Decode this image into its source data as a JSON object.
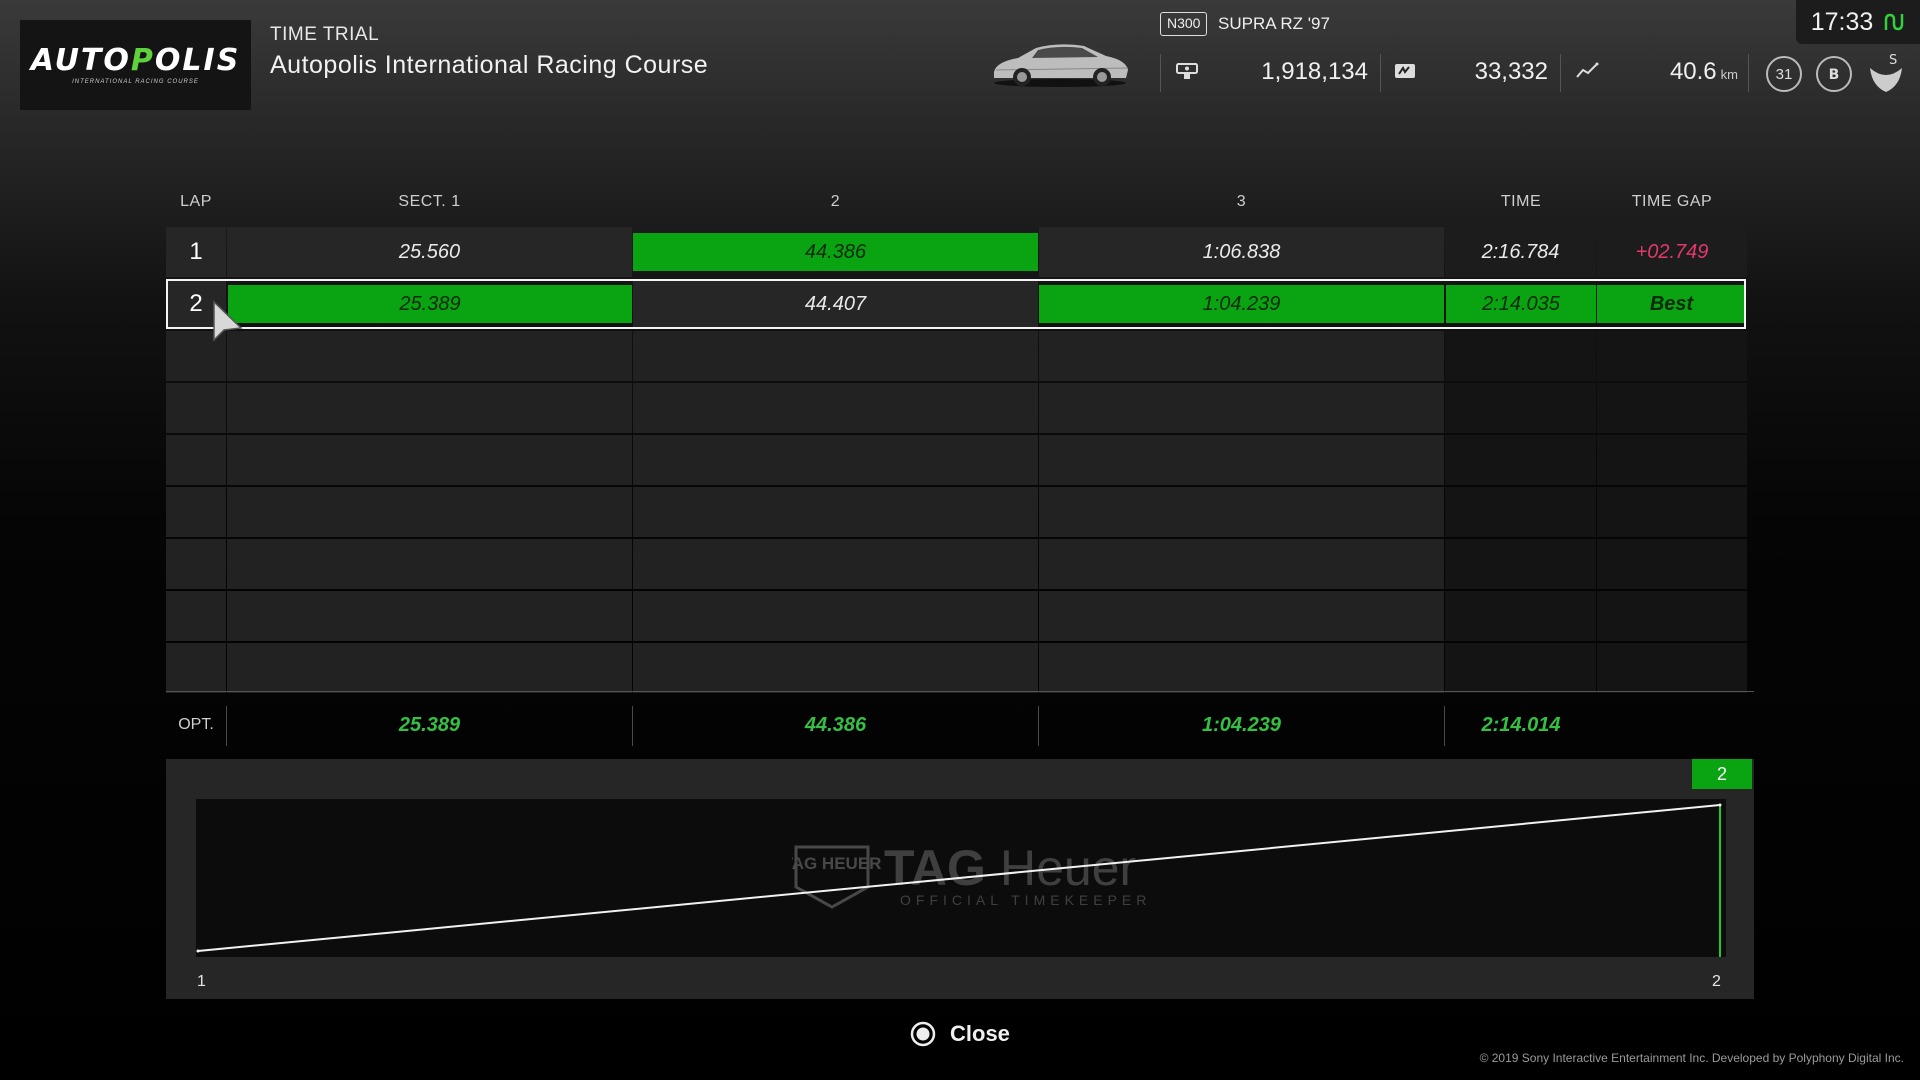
{
  "header": {
    "logo": {
      "text_white_1": "AUTO",
      "text_green": "P",
      "text_white_2": "OLIS",
      "subtitle": "INTERNATIONAL RACING COURSE"
    },
    "event_type": "TIME TRIAL",
    "track_name": "Autopolis International Racing Course",
    "car": {
      "class": "N300",
      "name": "SUPRA RZ '97"
    },
    "stats": {
      "credits": "1,918,134",
      "mileage_points": "33,332",
      "distance": "40.6",
      "distance_unit": "km",
      "level": "31"
    },
    "clock": "17:33",
    "icons": [
      "credits-icon",
      "mileage-icon",
      "distance-icon",
      "level-badge-icon",
      "driver-rating-icon",
      "sportsmanship-rating-icon",
      "network-status-icon"
    ]
  },
  "table": {
    "headers": {
      "lap": "LAP",
      "sect1": "SECT. 1",
      "sect2": "2",
      "sect3": "3",
      "time": "TIME",
      "gap": "TIME GAP"
    },
    "laps": [
      {
        "lap": "1",
        "sect1": "25.560",
        "sect2": "44.386",
        "sect3": "1:06.838",
        "time": "2:16.784",
        "gap": "+02.749"
      },
      {
        "lap": "2",
        "sect1": "25.389",
        "sect2": "44.407",
        "sect3": "1:04.239",
        "time": "2:14.035",
        "gap": "Best"
      }
    ],
    "selected_lap": "2",
    "optimal": {
      "label": "OPT.",
      "sect1": "25.389",
      "sect2": "44.386",
      "sect3": "1:04.239",
      "time": "2:14.014"
    },
    "colors": {
      "best_sector": "#0aa312",
      "optimal_text": "#35c043",
      "slower_gap": "#e3386c"
    }
  },
  "chart": {
    "badge": "2",
    "x_labels": [
      "1",
      "2"
    ],
    "watermark": {
      "brand_a": "TAG",
      "brand_b": "Heuer",
      "tagline": "OFFICIAL TIMEKEEPER",
      "shield": "TAG HEUER"
    }
  },
  "chart_data": {
    "type": "line",
    "x": [
      1,
      2
    ],
    "series": [
      {
        "values": [
          0,
          1
        ]
      }
    ],
    "xlabel": "",
    "ylabel": ""
  },
  "footer": {
    "close_label": "Close",
    "copyright": "© 2019 Sony Interactive Entertainment Inc. Developed by Polyphony Digital Inc."
  }
}
